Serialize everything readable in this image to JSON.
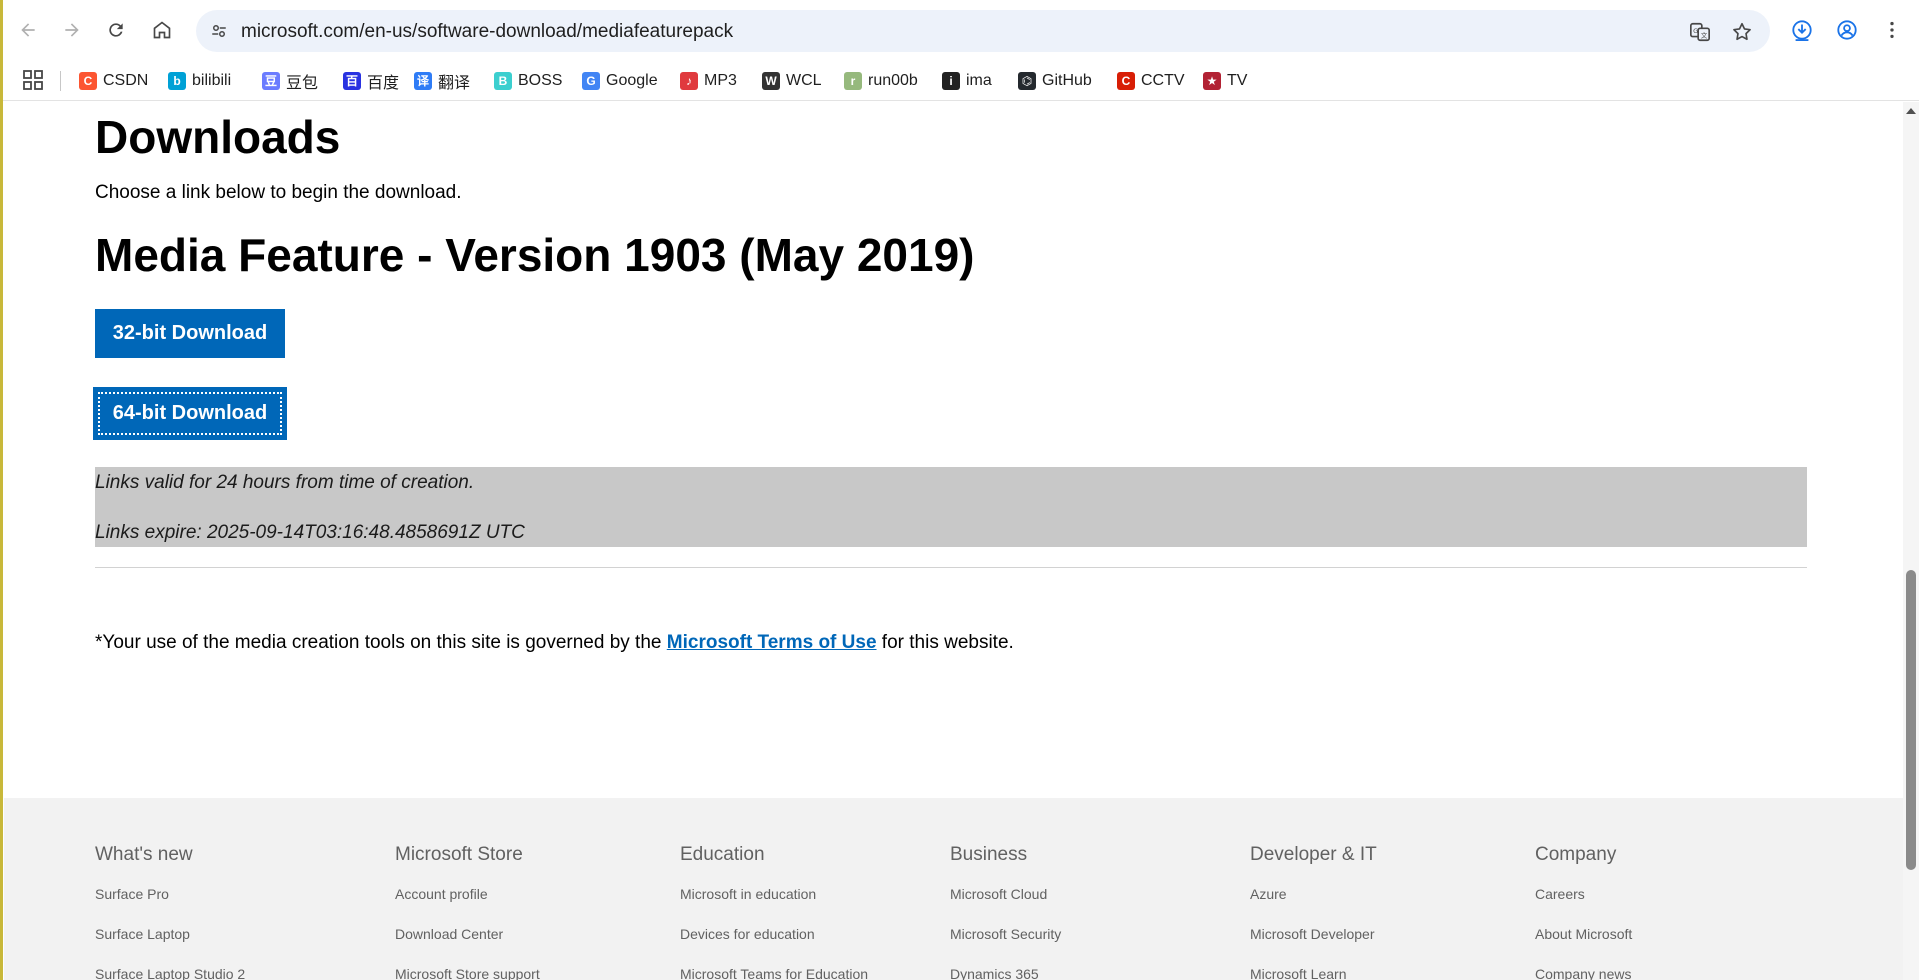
{
  "browser": {
    "url": "microsoft.com/en-us/software-download/mediafeaturepack",
    "bookmarks": [
      {
        "label": "CSDN",
        "icon": "csdn-icon",
        "color": "#fc5531",
        "glyph": "C"
      },
      {
        "label": "bilibili",
        "icon": "bilibili-icon",
        "color": "#00a1d6",
        "glyph": "b"
      },
      {
        "label": "豆包",
        "icon": "doubao-icon",
        "color": "#6b7cff",
        "glyph": "豆"
      },
      {
        "label": "百度",
        "icon": "baidu-icon",
        "color": "#2932e1",
        "glyph": "百"
      },
      {
        "label": "翻译",
        "icon": "translate-icon",
        "color": "#2e7cf6",
        "glyph": "译"
      },
      {
        "label": "BOSS",
        "icon": "boss-icon",
        "color": "#3ccfcf",
        "glyph": "B"
      },
      {
        "label": "Google",
        "icon": "google-icon",
        "color": "#4285f4",
        "glyph": "G"
      },
      {
        "label": "MP3",
        "icon": "mp3-icon",
        "color": "#e03a3e",
        "glyph": "♪"
      },
      {
        "label": "WCL",
        "icon": "wcl-icon",
        "color": "#333333",
        "glyph": "W"
      },
      {
        "label": "run00b",
        "icon": "runoob-icon",
        "color": "#96b97d",
        "glyph": "r"
      },
      {
        "label": "ima",
        "icon": "ima-icon",
        "color": "#222222",
        "glyph": "i"
      },
      {
        "label": "GitHub",
        "icon": "github-icon",
        "color": "#24292e",
        "glyph": "⌬"
      },
      {
        "label": "CCTV",
        "icon": "cctv-icon",
        "color": "#d81e06",
        "glyph": "C"
      },
      {
        "label": "TV",
        "icon": "tv-icon",
        "color": "#b22234",
        "glyph": "★"
      }
    ]
  },
  "page": {
    "heading_downloads": "Downloads",
    "choose_text": "Choose a link below to begin the download.",
    "heading_media": "Media Feature - Version 1903 (May 2019)",
    "btn_32": "32-bit Download",
    "btn_64": "64-bit Download",
    "notice_valid": "Links valid for 24 hours from time of creation.",
    "notice_expire": "Links expire: 2025-09-14T03:16:48.4858691Z UTC",
    "terms_prefix": "*Your use of the media creation tools on this site is governed by the ",
    "terms_link": "Microsoft Terms of Use",
    "terms_suffix": " for this website.",
    "accent_color": "#0067b8"
  },
  "footer": {
    "columns": [
      {
        "title": "What's new",
        "links": [
          "Surface Pro",
          "Surface Laptop",
          "Surface Laptop Studio 2"
        ]
      },
      {
        "title": "Microsoft Store",
        "links": [
          "Account profile",
          "Download Center",
          "Microsoft Store support"
        ]
      },
      {
        "title": "Education",
        "links": [
          "Microsoft in education",
          "Devices for education",
          "Microsoft Teams for Education"
        ]
      },
      {
        "title": "Business",
        "links": [
          "Microsoft Cloud",
          "Microsoft Security",
          "Dynamics 365"
        ]
      },
      {
        "title": "Developer & IT",
        "links": [
          "Azure",
          "Microsoft Developer",
          "Microsoft Learn"
        ]
      },
      {
        "title": "Company",
        "links": [
          "Careers",
          "About Microsoft",
          "Company news"
        ]
      }
    ]
  }
}
